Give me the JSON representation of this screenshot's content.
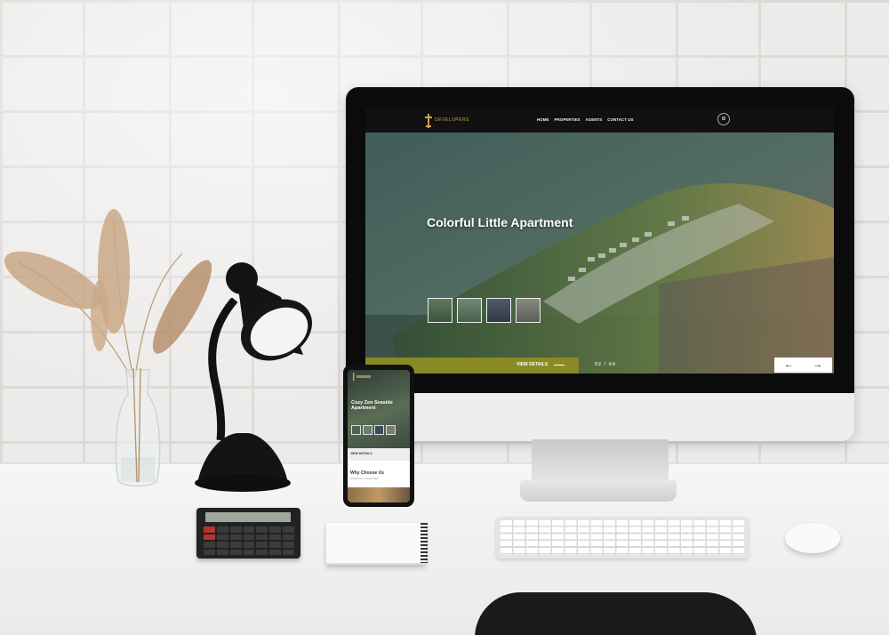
{
  "site": {
    "logo_text": "DEVELOPERS",
    "nav": [
      "HOME",
      "PROPERTIES",
      "AGENTS",
      "CONTACT US"
    ],
    "user_icon": "user-circle-icon",
    "hero": {
      "title": "Colorful Little Apartment",
      "cta_label": "VIEW DETAILS",
      "counter": "02 / 04",
      "prev_arrow": "←",
      "next_arrow": "→"
    }
  },
  "phone": {
    "title": "Cozy Zen Seaside Apartment",
    "view_details": "VIEW DETAILS",
    "section_title": "Why Choose Us",
    "section_sub": "WORKING TOGETHER"
  },
  "colors": {
    "brand_gold": "#c9a64a",
    "cta_olive": "#8a8a24",
    "nav_bg": "#111111"
  }
}
